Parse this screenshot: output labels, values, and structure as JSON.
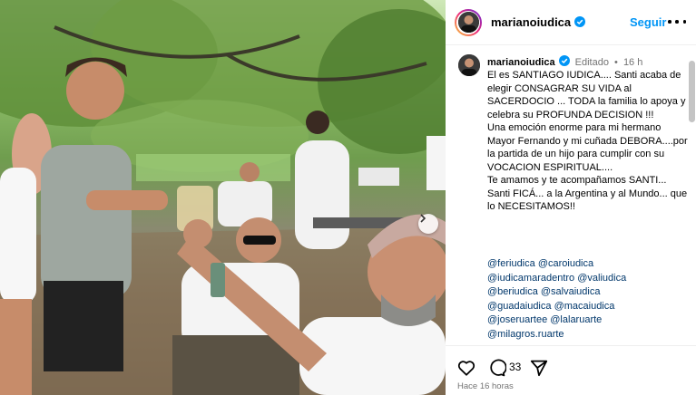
{
  "post": {
    "username": "marianoiudica",
    "follow_label": "Seguir",
    "edited_label": "Editado",
    "age": "16 h",
    "caption": [
      "El es SANTIAGO IUDICA.... Santi acaba de elegir CONSAGRAR SU VIDA al SACERDOCIO ... TODA la familia lo apoya y celebra su PROFUNDA DECISION !!!",
      "Una emoción enorme para mi hermano Mayor Fernando y mi cuñada DEBORA....por  la partida de un hijo para cumplir con su VOCACION ESPIRITUAL....",
      "Te amamos y te acompañamos SANTI... Santi FICÁ... a la Argentina y al Mundo... que lo NECESITAMOS!!"
    ],
    "tags": [
      "@feriudica",
      "@caroiudica",
      "@iudicamaradentro",
      "@valiudica",
      "@beriudica",
      "@salvaiudica",
      "@guadaiudica",
      "@macaiudica",
      "@joseruartee",
      "@lalaruarte",
      "@milagros.ruarte"
    ],
    "comment_count": "33",
    "timestamp": "Hace 16 horas"
  },
  "colors": {
    "accent": "#0095f6",
    "link": "#00376b",
    "muted": "#737373",
    "divider": "#efefef"
  },
  "icons": {
    "header_avatar": "avatar-icon",
    "verified": "verified-badge-icon",
    "more": "more-options-icon",
    "like": "heart-icon",
    "comment": "comment-icon",
    "share": "share-icon",
    "carousel_next": "chevron-right-icon"
  }
}
